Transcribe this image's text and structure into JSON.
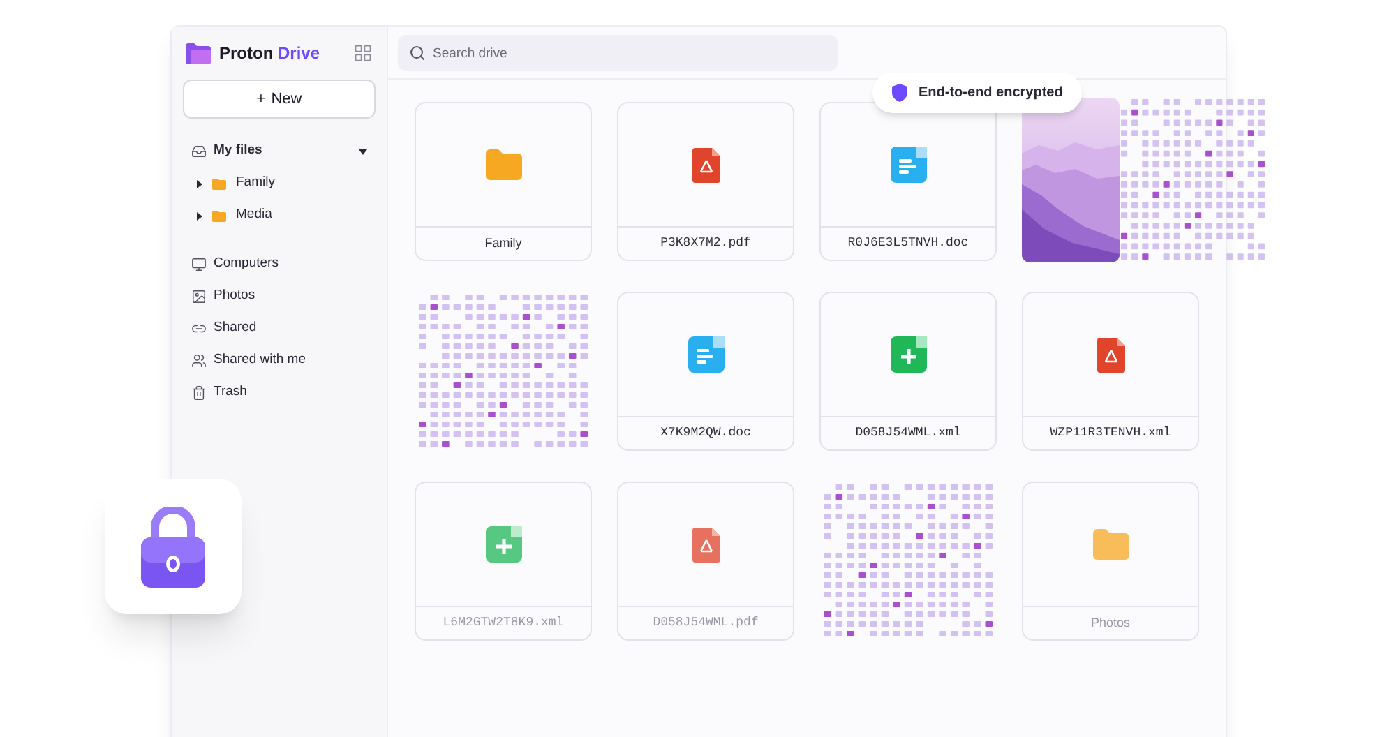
{
  "app": {
    "name_first": "Proton",
    "name_second": "Drive"
  },
  "new_button": {
    "icon": "+",
    "label": "New"
  },
  "sidebar": {
    "items": [
      {
        "kind": "my-files",
        "label": "My files",
        "expanded": true,
        "children": [
          {
            "label": "Family",
            "expanded": false
          },
          {
            "label": "Media",
            "expanded": false
          }
        ]
      },
      {
        "kind": "computers",
        "label": "Computers"
      },
      {
        "kind": "photos",
        "label": "Photos"
      },
      {
        "kind": "shared",
        "label": "Shared"
      },
      {
        "kind": "shared-with-me",
        "label": "Shared with me"
      },
      {
        "kind": "trash",
        "label": "Trash"
      }
    ]
  },
  "search": {
    "placeholder": "Search drive"
  },
  "badge": {
    "label": "End-to-end encrypted"
  },
  "files": [
    {
      "kind": "folder",
      "name": "Family",
      "dimmed": false
    },
    {
      "kind": "pdf",
      "name": "P3K8X7M2.pdf",
      "dimmed": false
    },
    {
      "kind": "doc",
      "name": "R0J6E3L5TNVH.doc",
      "dimmed": false
    },
    {
      "kind": "picture-encrypting"
    },
    {
      "kind": "encrypted"
    },
    {
      "kind": "doc",
      "name": "X7K9M2QW.doc",
      "dimmed": false
    },
    {
      "kind": "sheet",
      "name": "D058J54WML.xml",
      "dimmed": false
    },
    {
      "kind": "pdf",
      "name": "WZP11R3TENVH.xml",
      "dimmed": false
    },
    {
      "kind": "sheet",
      "name": "L6M2GTW2T8K9.xml",
      "dimmed": true
    },
    {
      "kind": "pdf",
      "name": "D058J54WML.pdf",
      "dimmed": true
    },
    {
      "kind": "encrypted"
    },
    {
      "kind": "folder",
      "name": "Photos",
      "dimmed": true
    }
  ]
}
